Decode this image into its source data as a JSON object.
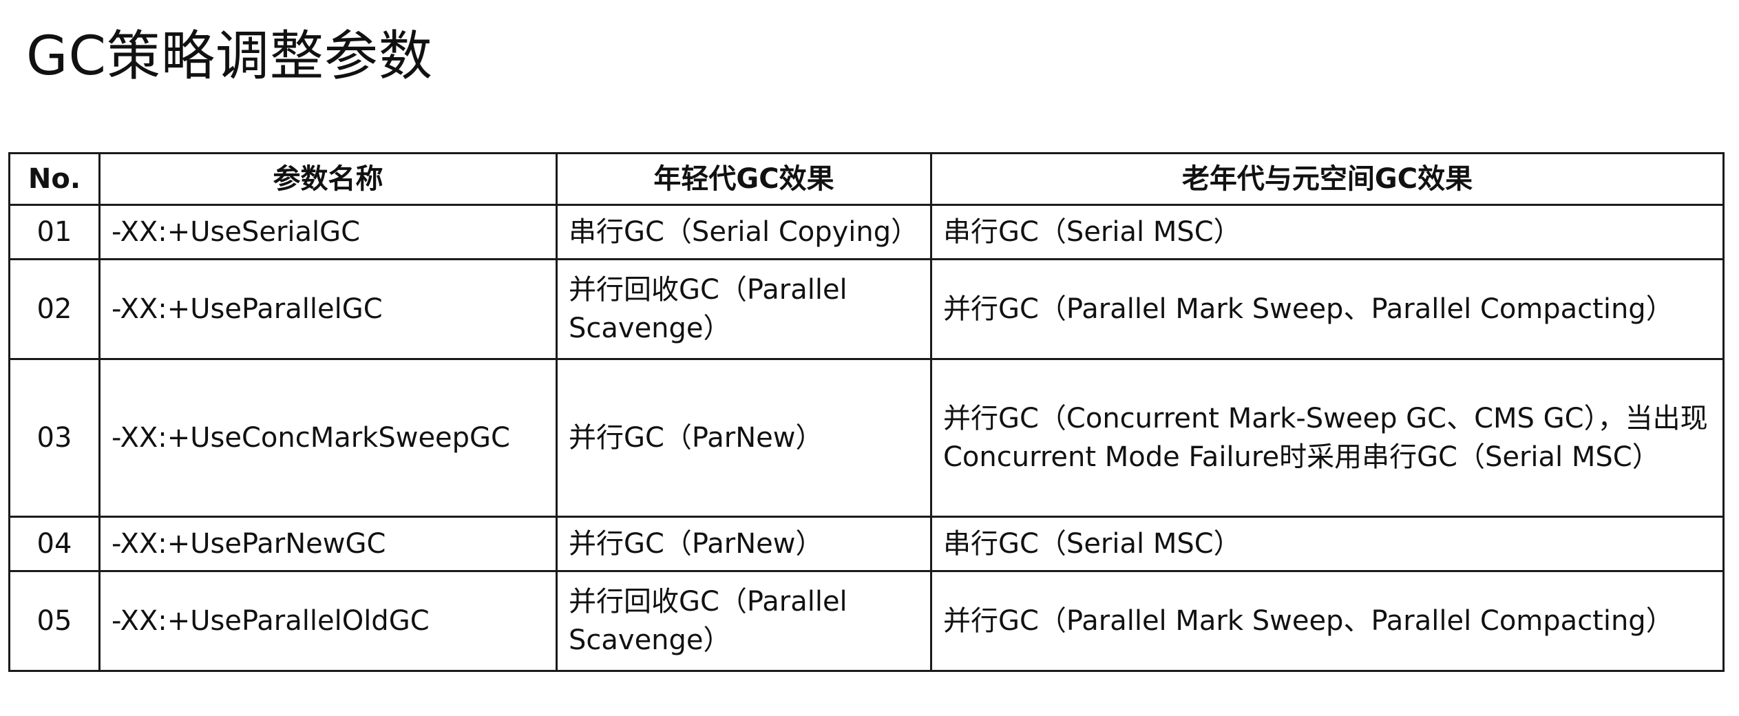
{
  "title": "GC策略调整参数",
  "table": {
    "headers": {
      "no": "No.",
      "param": "参数名称",
      "young": "年轻代GC效果",
      "old": "老年代与元空间GC效果"
    },
    "rows": [
      {
        "no": "01",
        "param": "-XX:+UseSerialGC",
        "young": "串行GC（Serial Copying）",
        "old": "串行GC（Serial MSC）"
      },
      {
        "no": "02",
        "param": "-XX:+UseParallelGC",
        "young": "并行回收GC（Parallel Scavenge）",
        "old": "并行GC（Parallel Mark Sweep、Parallel Compacting）"
      },
      {
        "no": "03",
        "param": "-XX:+UseConcMarkSweepGC",
        "young": "并行GC（ParNew）",
        "old": "并行GC（Concurrent Mark-Sweep GC、CMS GC），当出现Concurrent Mode Failure时采用串行GC（Serial MSC）"
      },
      {
        "no": "04",
        "param": "-XX:+UseParNewGC",
        "young": "并行GC（ParNew）",
        "old": "串行GC（Serial MSC）"
      },
      {
        "no": "05",
        "param": "-XX:+UseParallelOldGC",
        "young": "并行回收GC（Parallel Scavenge）",
        "old": "并行GC（Parallel Mark Sweep、Parallel Compacting）"
      }
    ]
  }
}
